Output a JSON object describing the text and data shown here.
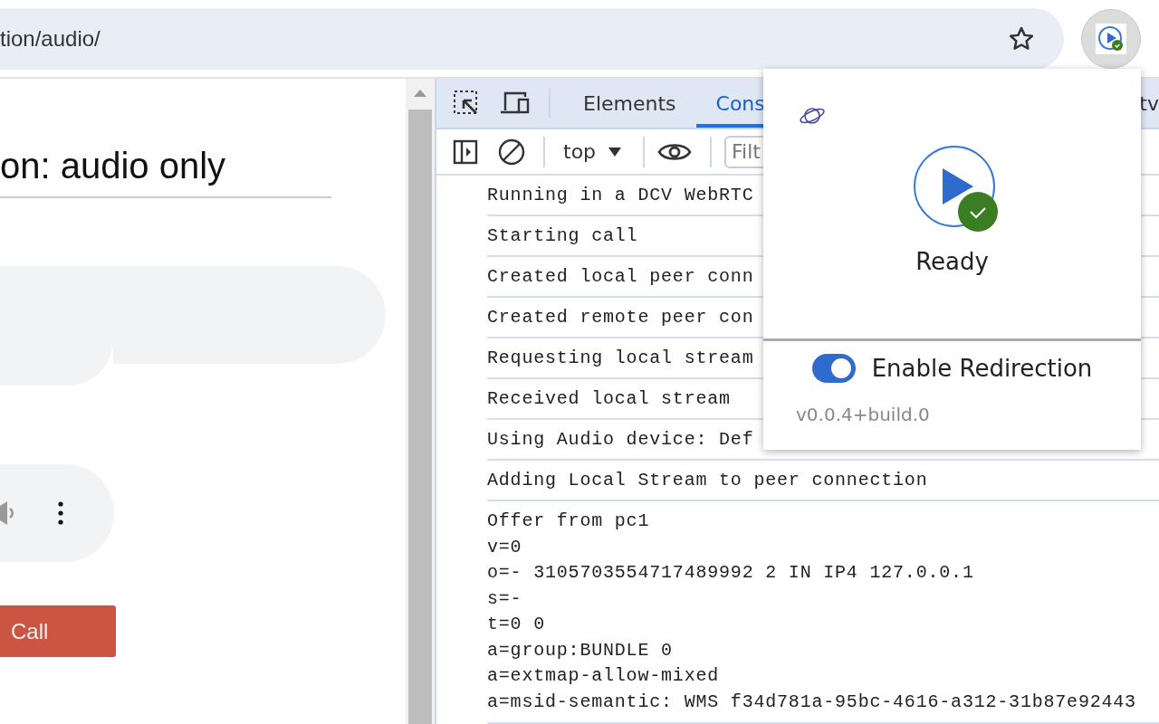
{
  "address_bar": {
    "url": "tion/audio/"
  },
  "page": {
    "heading": "on: audio only",
    "call_button": "Call"
  },
  "devtools": {
    "tabs": [
      {
        "label": "Elements",
        "selected": false
      },
      {
        "label": "Cons",
        "selected": true
      },
      {
        "label": "tv",
        "selected": false
      }
    ],
    "context": "top",
    "filter": {
      "placeholder": "Filt"
    },
    "log": [
      {
        "lines": [
          "Running in a DCV WebRTC"
        ]
      },
      {
        "lines": [
          "Starting call"
        ]
      },
      {
        "lines": [
          "Created local peer conn"
        ]
      },
      {
        "lines": [
          "Created remote peer con"
        ]
      },
      {
        "lines": [
          "Requesting local stream"
        ]
      },
      {
        "lines": [
          "Received local stream"
        ]
      },
      {
        "lines": [
          "Using Audio device: Def"
        ]
      },
      {
        "lines": [
          "Adding Local Stream to peer connection"
        ]
      },
      {
        "lines": [
          "Offer from pc1",
          "v=0",
          "o=- 3105703554717489992 2 IN IP4 127.0.0.1",
          "s=-",
          "t=0 0",
          "a=group:BUNDLE 0",
          "a=extmap-allow-mixed",
          "a=msid-semantic: WMS f34d781a-95bc-4616-a312-31b87e92443"
        ]
      }
    ]
  },
  "popup": {
    "status": "Ready",
    "toggle": {
      "label": "Enable Redirection",
      "on": true
    },
    "version": "v0.0.4+build.0"
  }
}
